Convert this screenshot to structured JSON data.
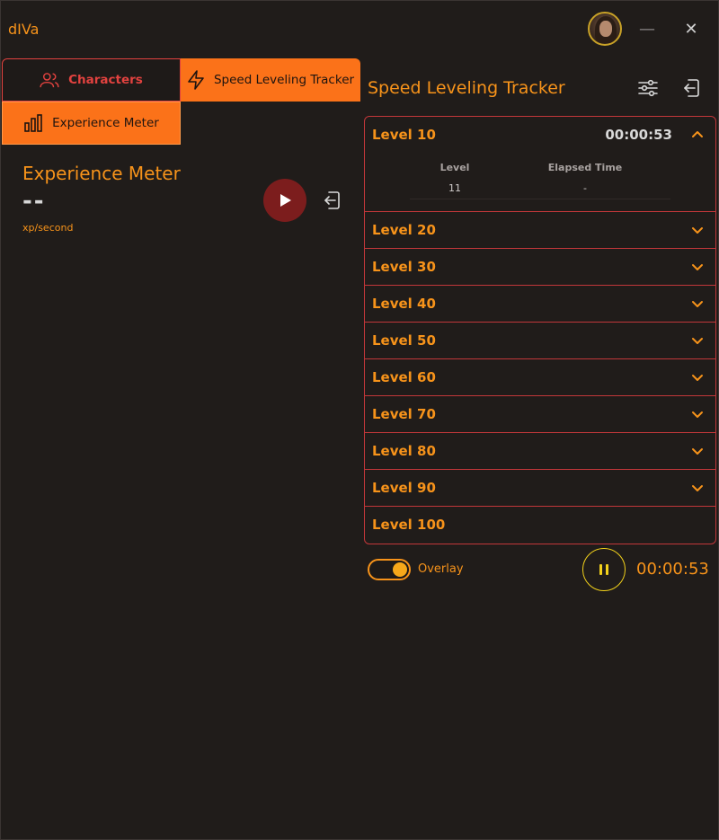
{
  "window": {
    "title": "dIVa"
  },
  "tabs": {
    "characters": "Characters",
    "speed_leveling": "Speed Leveling Tracker",
    "experience_meter": "Experience Meter"
  },
  "experience_meter": {
    "title": "Experience Meter",
    "value": "--",
    "unit": "xp/second"
  },
  "speed_tracker": {
    "title": "Speed Leveling Tracker",
    "levels": [
      {
        "label": "Level 10",
        "time": "00:00:53",
        "expanded": true,
        "table": {
          "headers": [
            "Level",
            "Elapsed Time"
          ],
          "rows": [
            [
              "11",
              "-"
            ]
          ]
        }
      },
      {
        "label": "Level 20"
      },
      {
        "label": "Level 30"
      },
      {
        "label": "Level 40"
      },
      {
        "label": "Level 50"
      },
      {
        "label": "Level 60"
      },
      {
        "label": "Level 70"
      },
      {
        "label": "Level 80"
      },
      {
        "label": "Level 90"
      },
      {
        "label": "Level 100"
      }
    ],
    "overlay_label": "Overlay",
    "overlay_enabled": true,
    "total_time": "00:00:53"
  },
  "colors": {
    "accent": "#f7931a",
    "tab_active": "#fb7219",
    "danger": "#e2423f",
    "background": "#201c1a",
    "pause_ring": "#f2d11b"
  },
  "icons": [
    "users-icon",
    "lightning-icon",
    "bar-chart-icon",
    "play-icon",
    "exit-icon",
    "sliders-icon",
    "chevron-up-icon",
    "chevron-down-icon",
    "pause-icon",
    "minimize-icon",
    "close-icon"
  ]
}
